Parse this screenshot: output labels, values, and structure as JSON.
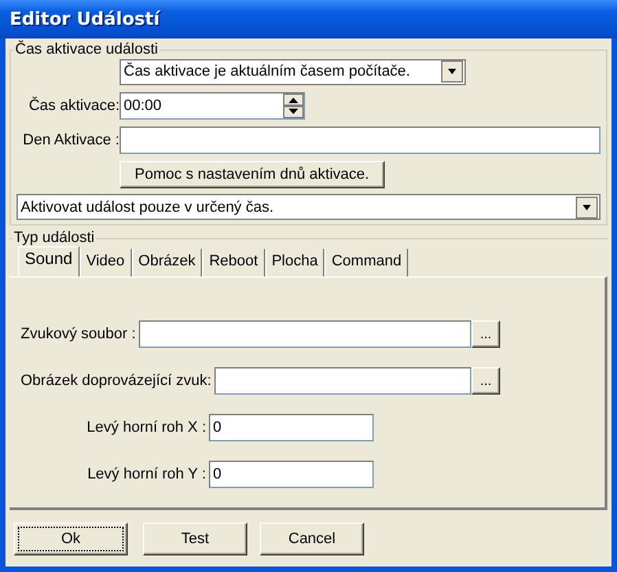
{
  "window": {
    "title": "Editor Událostí"
  },
  "activation": {
    "group_title": "Čas aktivace události",
    "mode": "Čas aktivace je aktuálním časem počítače.",
    "time_label": "Čas aktivace:",
    "time": "00:00",
    "day_label": "Den Aktivace :",
    "help_button": "Pomoc s nastavením dnů aktivace.",
    "repeat": "Aktivovat událost pouze v určený čas."
  },
  "event_type": {
    "group_title": "Typ události",
    "tabs": [
      {
        "label": "Sound",
        "selected": true
      },
      {
        "label": "Video",
        "selected": false
      },
      {
        "label": "Obrázek",
        "selected": false
      },
      {
        "label": "Reboot",
        "selected": false
      },
      {
        "label": "Plocha",
        "selected": false
      },
      {
        "label": "Command",
        "selected": false
      }
    ],
    "fields": [
      {
        "kind": "file",
        "label": "Zvukový soubor :",
        "browse_label": "..."
      },
      {
        "kind": "file",
        "label": "Obrázek doprovázející zvuk:",
        "browse_label": "..."
      },
      {
        "kind": "number",
        "label": "Levý horní roh X :",
        "value": "0"
      },
      {
        "kind": "number",
        "label": "Levý horní roh Y :",
        "value": "0"
      }
    ]
  },
  "buttons": [
    {
      "label": "Ok",
      "focused": true
    },
    {
      "label": "Test",
      "focused": false
    },
    {
      "label": "Cancel",
      "focused": false
    }
  ]
}
